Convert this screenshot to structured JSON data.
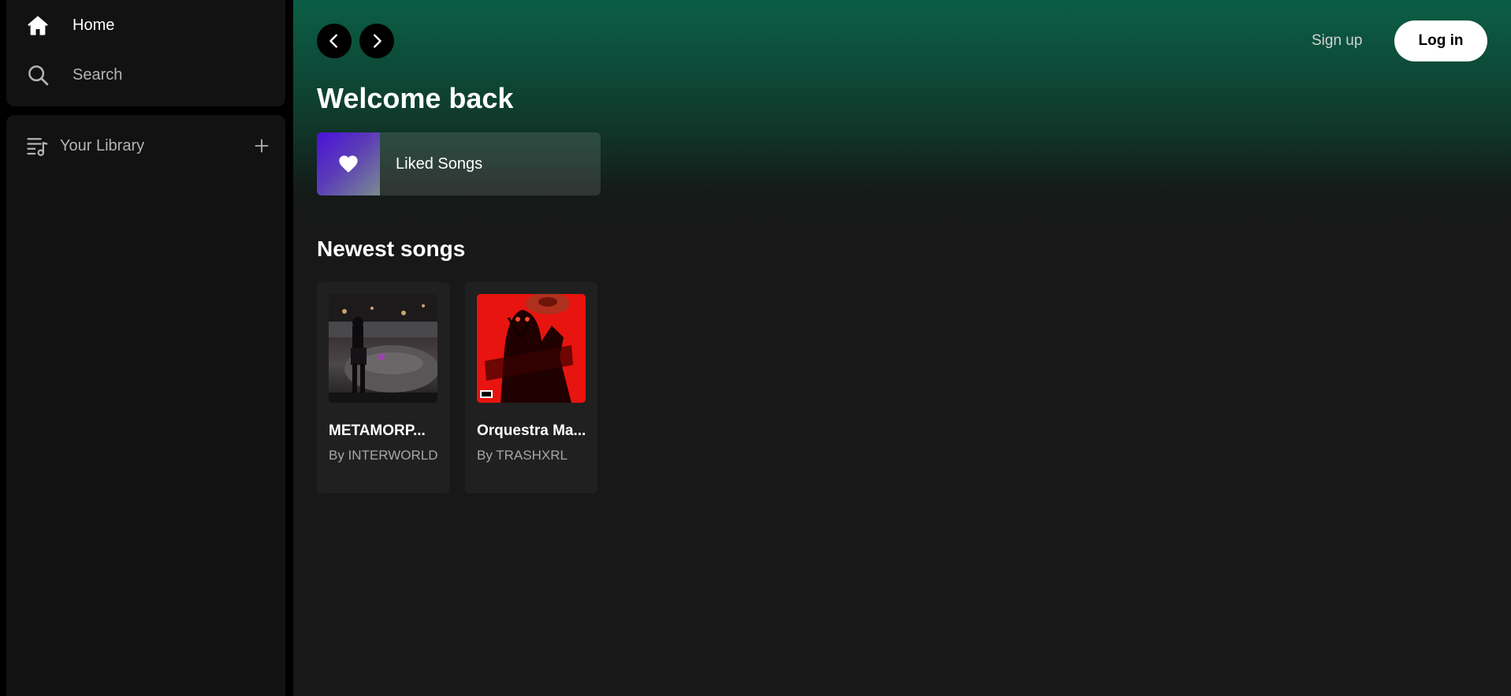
{
  "sidebar": {
    "nav": {
      "home_label": "Home",
      "search_label": "Search"
    },
    "library": {
      "label": "Your Library"
    }
  },
  "topbar": {
    "signup_label": "Sign up",
    "login_label": "Log in"
  },
  "main": {
    "greeting": "Welcome back",
    "liked_songs_label": "Liked Songs",
    "newest_section_title": "Newest songs",
    "songs": [
      {
        "title": "METAMORPHOSIS",
        "display_title": "METAMORP...",
        "artist_line": "By INTERWORLD"
      },
      {
        "title": "Orquestra Maldita",
        "display_title": "Orquestra Ma...",
        "artist_line": "By TRASHXRL"
      }
    ]
  },
  "icons": {
    "home": "home-icon",
    "search": "search-icon",
    "library": "library-icon",
    "plus": "plus-icon",
    "back": "chevron-left-icon",
    "forward": "chevron-right-icon",
    "heart": "heart-icon"
  },
  "colors": {
    "accent_gradient_top": "#0b5e45",
    "background": "#181818",
    "sidebar_bg": "#121212",
    "card_bg": "#202020",
    "muted_text": "#b3b3b3"
  }
}
